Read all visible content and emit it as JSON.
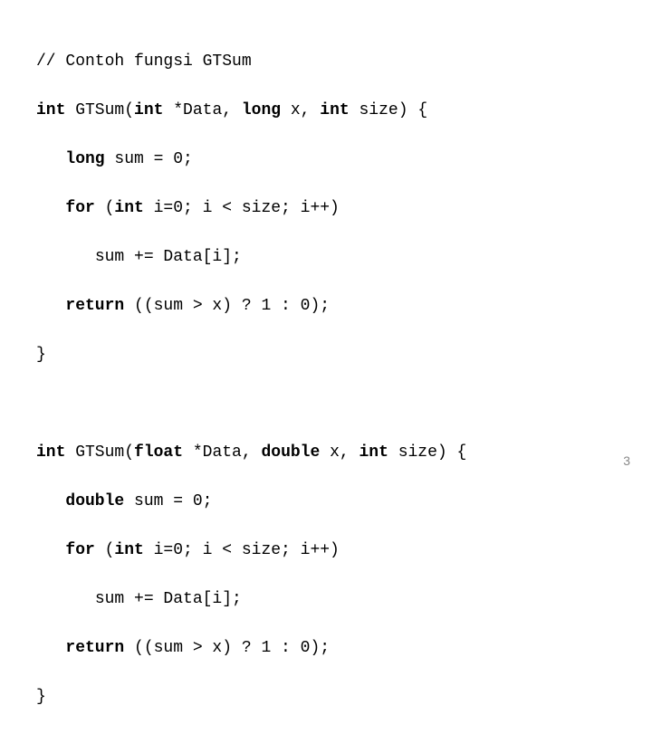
{
  "code": {
    "line1": "// Contoh fungsi GTSum",
    "line2_a": "int",
    "line2_b": " GTSum(",
    "line2_c": "int",
    "line2_d": " *Data, ",
    "line2_e": "long",
    "line2_f": " x, ",
    "line2_g": "int",
    "line2_h": " size) {",
    "line3_a": "long",
    "line3_b": " sum = 0;",
    "line4_a": "for",
    "line4_b": " (",
    "line4_c": "int",
    "line4_d": " i=0; i < size; i++)",
    "line5": "sum += Data[i];",
    "line6_a": "return",
    "line6_b": " ((sum > x) ? 1 : 0);",
    "line7": "}",
    "line8_a": "int",
    "line8_b": " GTSum(",
    "line8_c": "float",
    "line8_d": " *Data, ",
    "line8_e": "double",
    "line8_f": " x, ",
    "line8_g": "int",
    "line8_h": " size) {",
    "line9_a": "double",
    "line9_b": " sum = 0;",
    "line10_a": "for",
    "line10_b": " (",
    "line10_c": "int",
    "line10_d": " i=0; i < size; i++)",
    "line11": "sum += Data[i];",
    "line12_a": "return",
    "line12_b": " ((sum > x) ? 1 : 0);",
    "line13": "}"
  },
  "page_number": "3",
  "indent1": "   ",
  "indent2": "      "
}
